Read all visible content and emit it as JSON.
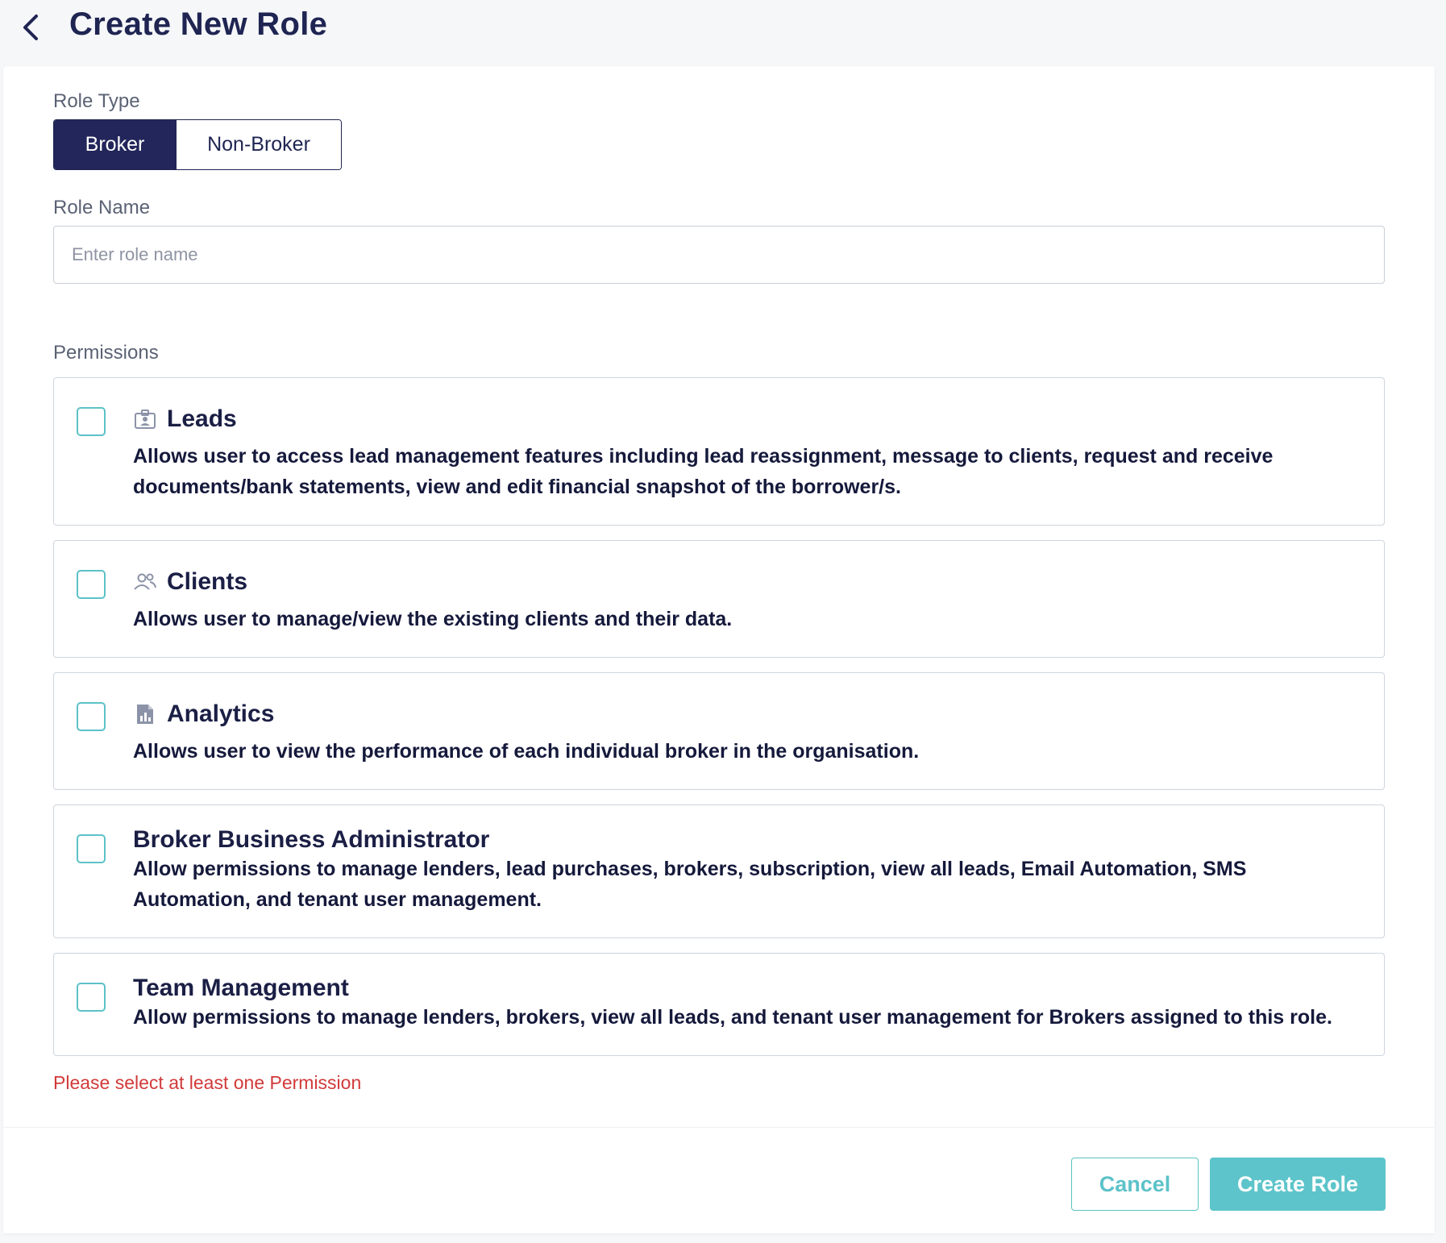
{
  "header": {
    "title": "Create New Role",
    "back_icon": "chevron-left-icon"
  },
  "role_type": {
    "label": "Role Type",
    "options": [
      "Broker",
      "Non-Broker"
    ],
    "selected": "Broker"
  },
  "role_name": {
    "label": "Role Name",
    "value": "",
    "placeholder": "Enter role name"
  },
  "permissions": {
    "label": "Permissions",
    "items": [
      {
        "title": "Leads",
        "icon": "id-badge-icon",
        "checked": false,
        "description": "Allows user to access lead management features including lead reassignment, message to clients, request and receive documents/bank statements, view and edit financial snapshot of the borrower/s."
      },
      {
        "title": "Clients",
        "icon": "users-icon",
        "checked": false,
        "description": "Allows user to manage/view the existing clients and their data."
      },
      {
        "title": "Analytics",
        "icon": "report-chart-icon",
        "checked": false,
        "description": "Allows user to view the performance of each individual broker in the organisation."
      },
      {
        "title": "Broker Business Administrator",
        "checked": false,
        "description": "Allow permissions to manage lenders, lead purchases, brokers, subscription, view all leads, Email Automation, SMS Automation, and tenant user management."
      },
      {
        "title": "Team Management",
        "checked": false,
        "description": "Allow permissions to manage lenders, brokers, view all leads, and tenant user management for Brokers assigned to this role."
      }
    ],
    "error": "Please select at least one Permission"
  },
  "footer": {
    "cancel_label": "Cancel",
    "create_label": "Create Role"
  },
  "colors": {
    "primary_dark": "#22265a",
    "accent_teal": "#5cc2c8",
    "error_red": "#d13a3a"
  }
}
